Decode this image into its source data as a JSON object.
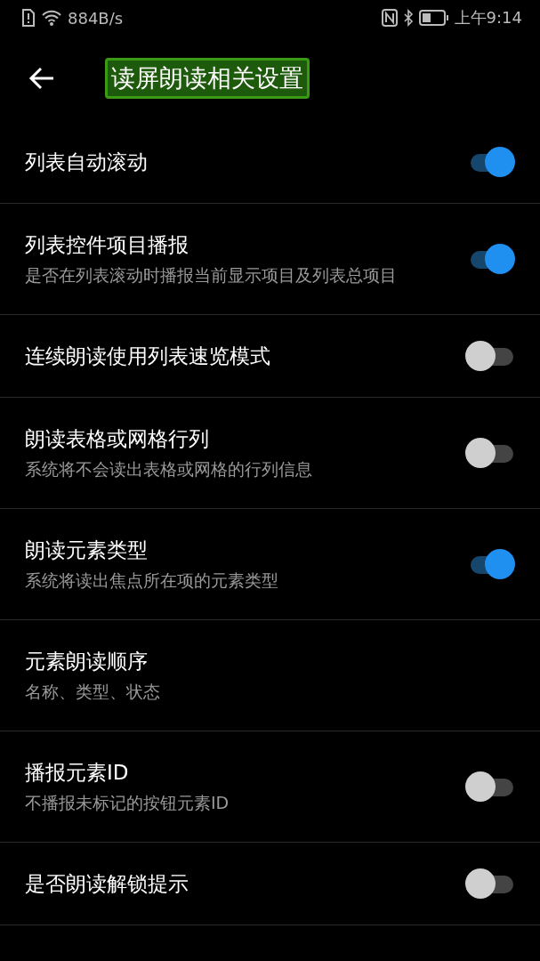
{
  "status_bar": {
    "speed": "884B/s",
    "time": "上午9:14"
  },
  "header": {
    "title": "读屏朗读相关设置",
    "focused": true
  },
  "settings": [
    {
      "title": "列表自动滚动",
      "on": true
    },
    {
      "title": "列表控件项目播报",
      "subtitle": "是否在列表滚动时播报当前显示项目及列表总项目",
      "on": true
    },
    {
      "title": "连续朗读使用列表速览模式",
      "on": false
    },
    {
      "title": "朗读表格或网格行列",
      "subtitle": "系统将不会读出表格或网格的行列信息",
      "on": false
    },
    {
      "title": "朗读元素类型",
      "subtitle": "系统将读出焦点所在项的元素类型",
      "on": true
    },
    {
      "title": "元素朗读顺序",
      "subtitle": "名称、类型、状态"
    },
    {
      "title": "播报元素ID",
      "subtitle": "不播报未标记的按钮元素ID",
      "on": false
    },
    {
      "title": "是否朗读解锁提示",
      "on": false
    }
  ]
}
